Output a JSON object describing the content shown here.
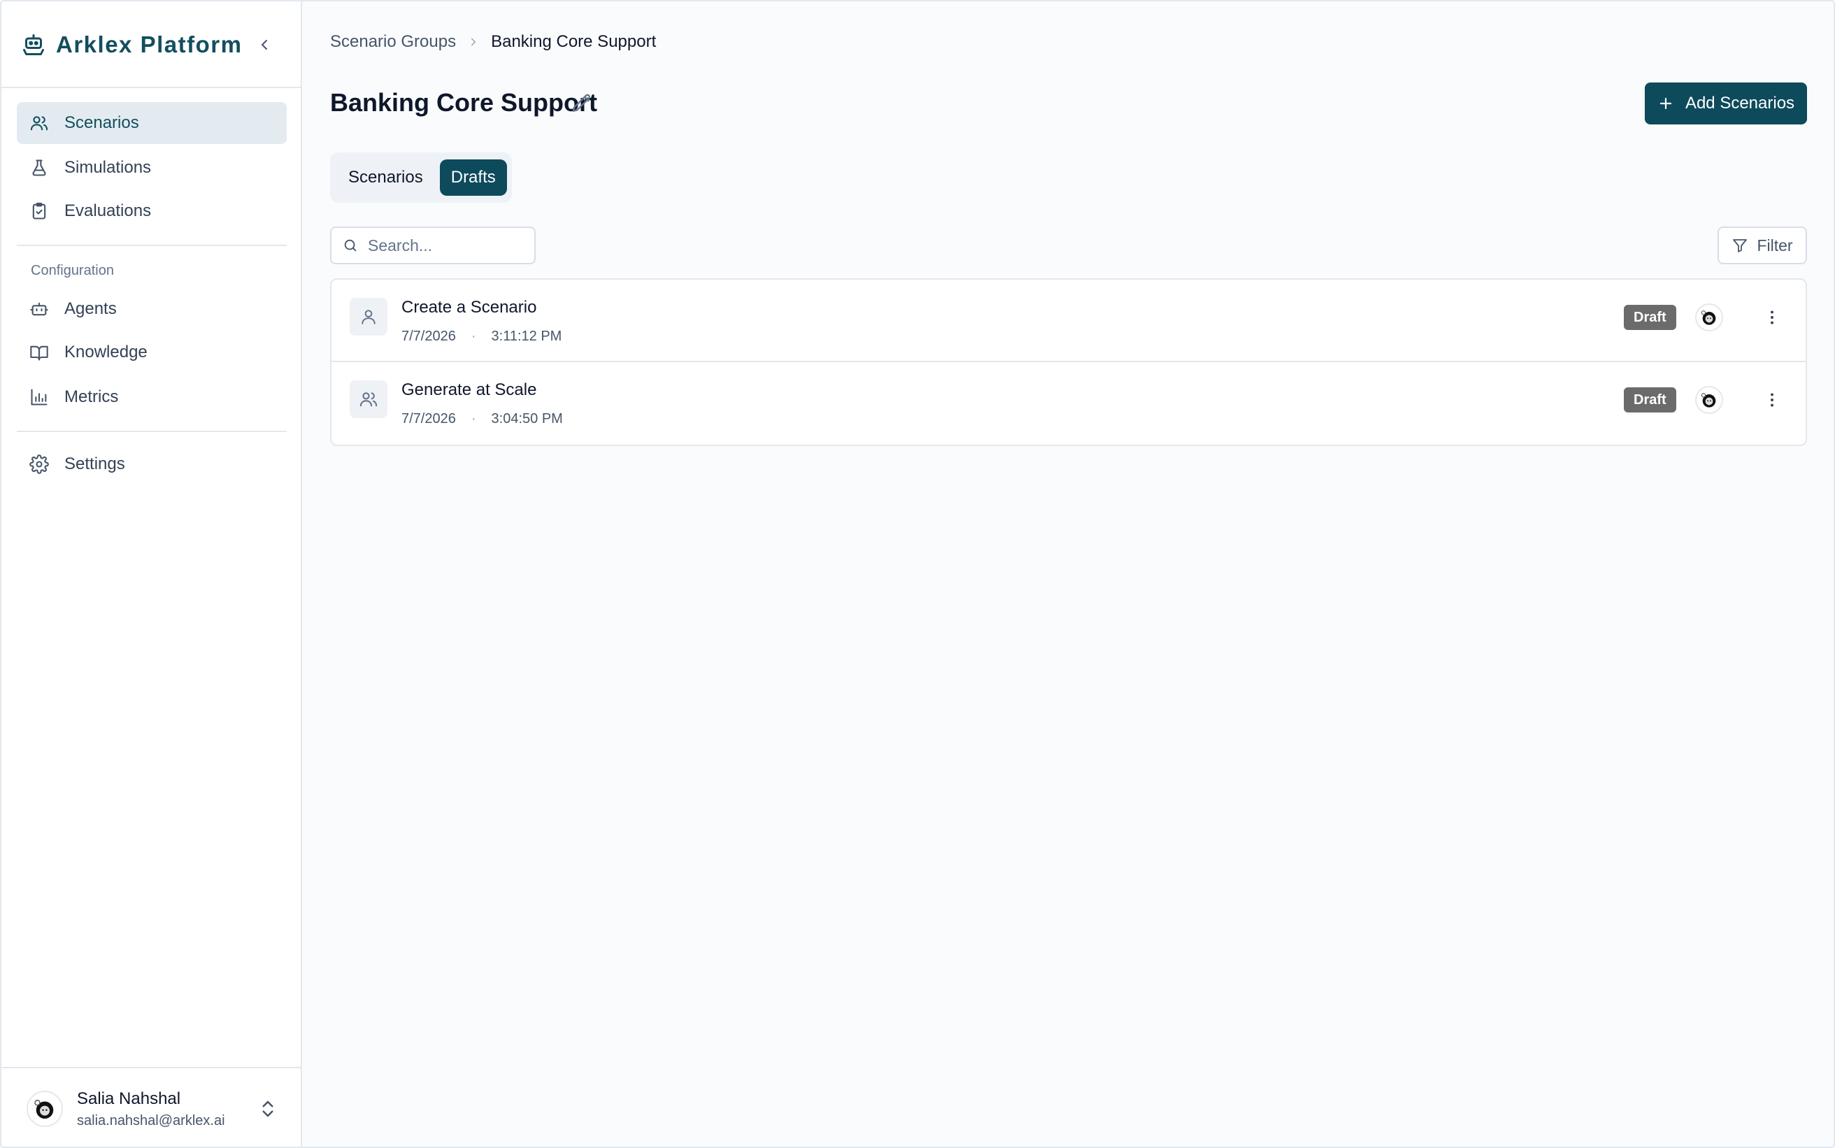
{
  "app": {
    "brand_name": "Arklex Platform",
    "colors": {
      "accent": "#0d4a5c",
      "brand_text": "#134e5e",
      "badge": "#6b6b6b"
    }
  },
  "sidebar": {
    "items": [
      {
        "label": "Scenarios",
        "icon": "users-icon",
        "active": true
      },
      {
        "label": "Simulations",
        "icon": "flask-icon"
      },
      {
        "label": "Evaluations",
        "icon": "clipboard-check-icon"
      }
    ],
    "config_label": "Configuration",
    "config_items": [
      {
        "label": "Agents",
        "icon": "bot-icon"
      },
      {
        "label": "Knowledge",
        "icon": "book-icon"
      },
      {
        "label": "Metrics",
        "icon": "bar-chart-icon"
      }
    ],
    "settings_label": "Settings"
  },
  "user": {
    "name": "Salia Nahshal",
    "email": "salia.nahshal@arklex.ai"
  },
  "breadcrumb": {
    "parent": "Scenario Groups",
    "current": "Banking Core Support"
  },
  "page": {
    "title": "Banking Core Support"
  },
  "actions": {
    "add_label": "Add Scenarios",
    "filter_label": "Filter"
  },
  "tabs": [
    {
      "label": "Scenarios",
      "active": false
    },
    {
      "label": "Drafts",
      "active": true
    }
  ],
  "search": {
    "placeholder": "Search...",
    "value": ""
  },
  "rows": [
    {
      "title": "Create a Scenario",
      "date": "7/7/2026",
      "time": "3:11:12 PM",
      "badge": "Draft",
      "icon": "user-icon"
    },
    {
      "title": "Generate at Scale",
      "date": "7/7/2026",
      "time": "3:04:50 PM",
      "badge": "Draft",
      "icon": "users-icon"
    }
  ]
}
